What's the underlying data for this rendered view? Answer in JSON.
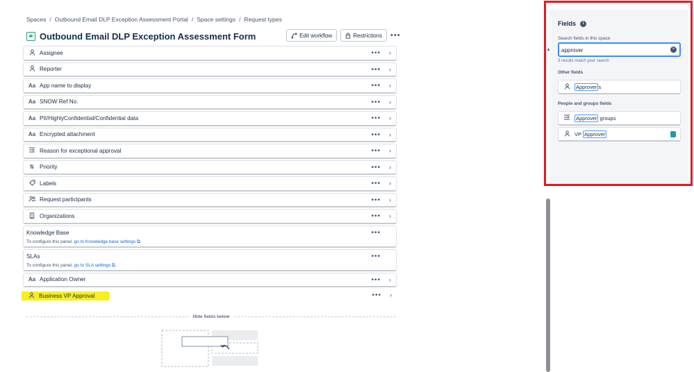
{
  "breadcrumb": {
    "items": [
      "Spaces",
      "Outbound Email DLP Exception Assessment Portal",
      "Space settings",
      "Request types"
    ],
    "separator": "/"
  },
  "header": {
    "title": "Outbound Email DLP Exception Assessment Form",
    "edit_workflow": "Edit workflow",
    "restrictions": "Restrictions",
    "more": "•••"
  },
  "fields": [
    {
      "label": "Assignee",
      "icon": "user-icon"
    },
    {
      "label": "Reporter",
      "icon": "user-icon"
    },
    {
      "label": "App name to display",
      "icon": "text-field-icon"
    },
    {
      "label": "SNOW Ref No.",
      "icon": "text-field-icon"
    },
    {
      "label": "PII/HighlyConfidential/Confidential data",
      "icon": "text-field-icon"
    },
    {
      "label": "Encrypted attachment",
      "icon": "text-field-icon"
    },
    {
      "label": "Reason for exceptional approval",
      "icon": "paragraph-icon"
    },
    {
      "label": "Priority",
      "icon": "priority-icon"
    },
    {
      "label": "Labels",
      "icon": "tag-icon"
    },
    {
      "label": "Request participants",
      "icon": "people-icon"
    },
    {
      "label": "Organizations",
      "icon": "building-icon"
    }
  ],
  "panels": {
    "knowledge": {
      "title": "Knowledge Base",
      "desc": "To configure this panel,",
      "link": "go to Knowledge base settings"
    },
    "slas": {
      "title": "SLAs",
      "desc": "To configure this panel,",
      "link": "go to SLA settings"
    }
  },
  "fields_after": [
    {
      "label": "Application Owner",
      "icon": "text-field-icon"
    },
    {
      "label": "Business VP Approval",
      "icon": "user-icon",
      "highlighted": true
    }
  ],
  "hide_fields_label": "Hide fields below",
  "side_panel": {
    "title": "Fields",
    "search_label": "Search fields in this space",
    "search_value": "approver",
    "match_text": "3 results match your search",
    "other_fields_title": "Other fields",
    "other_fields": [
      {
        "match": "Approver",
        "rest": "s"
      }
    ],
    "people_title": "People and groups fields",
    "people_fields": [
      {
        "prefix": "",
        "match": "Approver",
        "rest": " groups",
        "icon": "paragraph-icon"
      },
      {
        "prefix": "VP ",
        "match": "Approver",
        "rest": "",
        "icon": "user-icon"
      }
    ]
  },
  "colors": {
    "highlight": "#f7ef1f",
    "frame": "#e4191f",
    "link": "#0c66e4",
    "focus": "#388bff"
  }
}
